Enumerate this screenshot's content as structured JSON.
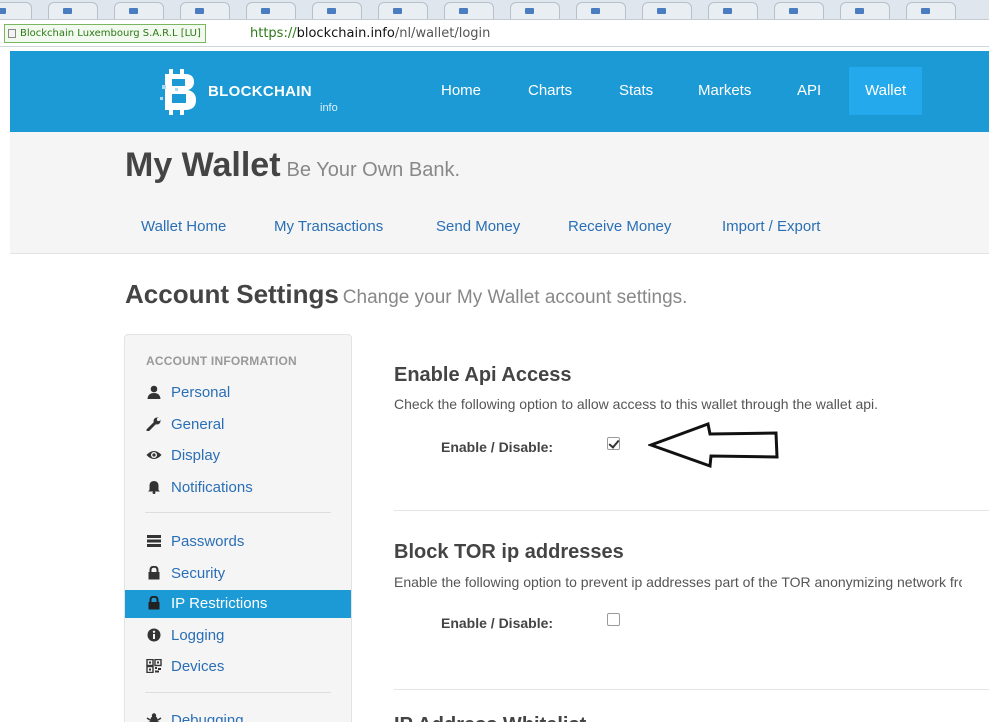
{
  "browser": {
    "ev_badge": "Blockchain Luxembourg S.A.R.L [LU]",
    "url_scheme": "https://",
    "url_host": "blockchain.info",
    "url_path": "/nl/wallet/login"
  },
  "navbar": {
    "brand_name": "BLOCKCHAIN",
    "brand_sub": "info",
    "items": [
      "Home",
      "Charts",
      "Stats",
      "Markets",
      "API",
      "Wallet"
    ],
    "active_item": "Wallet"
  },
  "wallet_header": {
    "title": "My Wallet",
    "tagline": "Be Your Own Bank.",
    "subnav": [
      "Wallet Home",
      "My Transactions",
      "Send Money",
      "Receive Money",
      "Import / Export"
    ]
  },
  "account": {
    "title": "Account Settings",
    "subtitle": "Change your My Wallet account settings."
  },
  "sidebar": {
    "heading": "ACCOUNT INFORMATION",
    "items": [
      {
        "label": "Personal",
        "icon": "user-icon"
      },
      {
        "label": "General",
        "icon": "wrench-icon"
      },
      {
        "label": "Display",
        "icon": "eye-icon"
      },
      {
        "label": "Notifications",
        "icon": "bell-icon"
      },
      {
        "label": "Passwords",
        "icon": "list-icon"
      },
      {
        "label": "Security",
        "icon": "lock-icon"
      },
      {
        "label": "IP Restrictions",
        "icon": "lock-icon"
      },
      {
        "label": "Logging",
        "icon": "info-icon"
      },
      {
        "label": "Devices",
        "icon": "qrcode-icon"
      },
      {
        "label": "Debugging",
        "icon": "bug-icon"
      }
    ],
    "active_item": "IP Restrictions"
  },
  "sections": [
    {
      "title": "Enable Api Access",
      "description": "Check the following option to allow access to this wallet through the wallet api.",
      "toggle_label": "Enable / Disable:",
      "checked": true
    },
    {
      "title": "Block TOR ip addresses",
      "description": "Enable the following option to prevent ip addresses part of the TOR anonymizing network from accessing your wallet.",
      "toggle_label": "Enable / Disable:",
      "checked": false
    },
    {
      "title": "IP Address Whitelist"
    }
  ],
  "colors": {
    "brand_blue": "#1b9ad6",
    "active_blue": "#23a9ec",
    "link_blue": "#2a6fb5"
  }
}
